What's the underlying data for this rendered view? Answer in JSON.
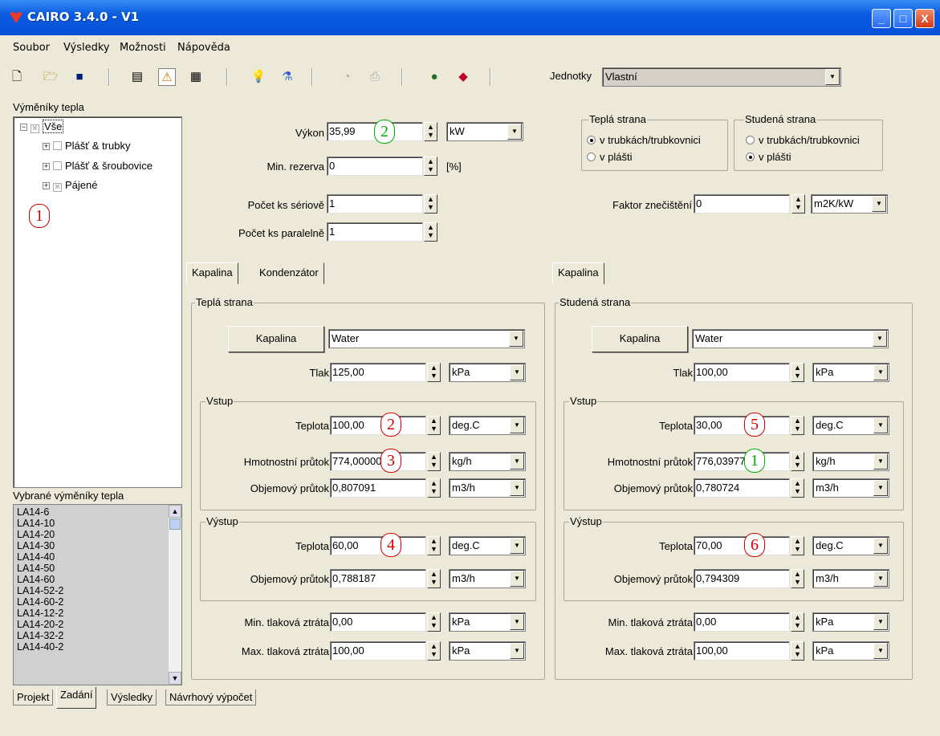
{
  "window": {
    "title": "CAIRO 3.4.0 - V1",
    "minimize": "_",
    "maximize": "□",
    "close": "X"
  },
  "menu": [
    "Soubor",
    "Výsledky",
    "Možnosti",
    "Nápověda"
  ],
  "toolbar": {
    "icons": [
      "new-file-icon",
      "open-folder-icon",
      "save-icon",
      "document-icon",
      "warning-icon",
      "table-icon",
      "lightbulb-icon",
      "flask-icon",
      "chart-icon",
      "print-icon",
      "globe-icon",
      "diamond-icon"
    ],
    "units_label": "Jednotky",
    "units_value": "Vlastní"
  },
  "left": {
    "tree_title": "Výměníky tepla",
    "tree": [
      {
        "label": "Vše"
      },
      {
        "label": "Plášť & trubky"
      },
      {
        "label": "Plášť & šroubovice"
      },
      {
        "label": "Pájené"
      }
    ],
    "tree_badge": "1",
    "selected_title": "Vybrané výměníky tepla",
    "selected": [
      "LA14-6",
      "LA14-10",
      "LA14-20",
      "LA14-30",
      "LA14-40",
      "LA14-50",
      "LA14-60",
      "LA14-52-2",
      "LA14-60-2",
      "LA14-12-2",
      "LA14-20-2",
      "LA14-32-2",
      "LA14-40-2"
    ]
  },
  "top": {
    "vykon_label": "Výkon",
    "vykon_value": "35,99",
    "vykon_unit": "kW",
    "vykon_badge": "2",
    "rezerva_label": "Min. rezerva",
    "rezerva_value": "0",
    "rezerva_unit": "[%]",
    "serial_label": "Počet ks sériově",
    "serial_value": "1",
    "parallel_label": "Počet ks paralelně",
    "parallel_value": "1",
    "hot_side_title": "Teplá strana",
    "hot_opt1": "v trubkách/trubkovnici",
    "hot_opt2": "v plášti",
    "cold_side_title": "Studená strana",
    "cold_opt1": "v trubkách/trubkovnici",
    "cold_opt2": "v plášti",
    "fouling_label": "Faktor znečištění",
    "fouling_value": "0",
    "fouling_unit": "m2K/kW"
  },
  "hot": {
    "tabs": [
      "Kapalina",
      "Kondenzátor"
    ],
    "group_title": "Teplá strana",
    "fluid_button": "Kapalina",
    "fluid": "Water",
    "pressure_label": "Tlak",
    "pressure": "125,00",
    "pressure_unit": "kPa",
    "inlet_title": "Vstup",
    "in_temp_label": "Teplota",
    "in_temp": "100,00",
    "in_temp_unit": "deg.C",
    "in_temp_badge": "2",
    "mass_label": "Hmotnostní průtok",
    "mass": "774,000000",
    "mass_unit": "kg/h",
    "mass_badge": "3",
    "vol_label": "Objemový průtok",
    "vol": "0,807091",
    "vol_unit": "m3/h",
    "outlet_title": "Výstup",
    "out_temp_label": "Teplota",
    "out_temp": "60,00",
    "out_temp_unit": "deg.C",
    "out_temp_badge": "4",
    "out_vol_label": "Objemový průtok",
    "out_vol": "0,788187",
    "out_vol_unit": "m3/h",
    "min_dp_label": "Min. tlaková ztráta",
    "min_dp": "0,00",
    "min_dp_unit": "kPa",
    "max_dp_label": "Max. tlaková ztráta",
    "max_dp": "100,00",
    "max_dp_unit": "kPa"
  },
  "cold": {
    "tabs": [
      "Kapalina"
    ],
    "group_title": "Studená strana",
    "fluid_button": "Kapalina",
    "fluid": "Water",
    "pressure_label": "Tlak",
    "pressure": "100,00",
    "pressure_unit": "kPa",
    "inlet_title": "Vstup",
    "in_temp_label": "Teplota",
    "in_temp": "30,00",
    "in_temp_unit": "deg.C",
    "in_temp_badge": "5",
    "mass_label": "Hmotnostní průtok",
    "mass": "776,039770",
    "mass_unit": "kg/h",
    "mass_badge": "1",
    "vol_label": "Objemový průtok",
    "vol": "0,780724",
    "vol_unit": "m3/h",
    "outlet_title": "Výstup",
    "out_temp_label": "Teplota",
    "out_temp": "70,00",
    "out_temp_unit": "deg.C",
    "out_temp_badge": "6",
    "out_vol_label": "Objemový průtok",
    "out_vol": "0,794309",
    "out_vol_unit": "m3/h",
    "min_dp_label": "Min. tlaková ztráta",
    "min_dp": "0,00",
    "min_dp_unit": "kPa",
    "max_dp_label": "Max. tlaková ztráta",
    "max_dp": "100,00",
    "max_dp_unit": "kPa"
  },
  "bottom_tabs": [
    "Projekt",
    "Zadání",
    "Výsledky",
    "Návrhový výpočet"
  ]
}
